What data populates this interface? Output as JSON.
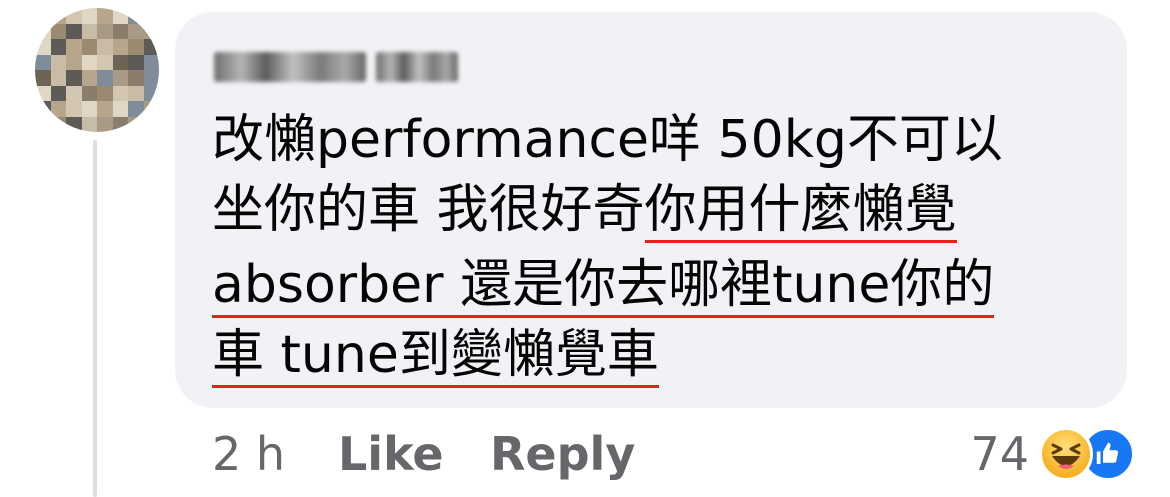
{
  "comment": {
    "author_redacted": true,
    "lines": [
      [
        {
          "t": "改懶performance咩 50kg不可以",
          "u": false
        }
      ],
      [
        {
          "t": "坐你的車 我很好奇",
          "u": false
        },
        {
          "t": "你用什麼懶覺",
          "u": true
        }
      ],
      [
        {
          "t": "absorber 還是你去哪裡tune你的",
          "u": true
        }
      ],
      [
        {
          "t": "車 tune到變懶覺車",
          "u": true
        }
      ]
    ]
  },
  "actions": {
    "time": "2 h",
    "like": "Like",
    "reply": "Reply"
  },
  "reactions": {
    "count": "74",
    "types": [
      "haha-icon",
      "like-icon"
    ]
  },
  "colors": {
    "bubble_bg": "#f0f2f5",
    "text": "#050505",
    "meta_text": "#65676b",
    "underline": "#e4201a",
    "like_blue": "#1877f2"
  }
}
